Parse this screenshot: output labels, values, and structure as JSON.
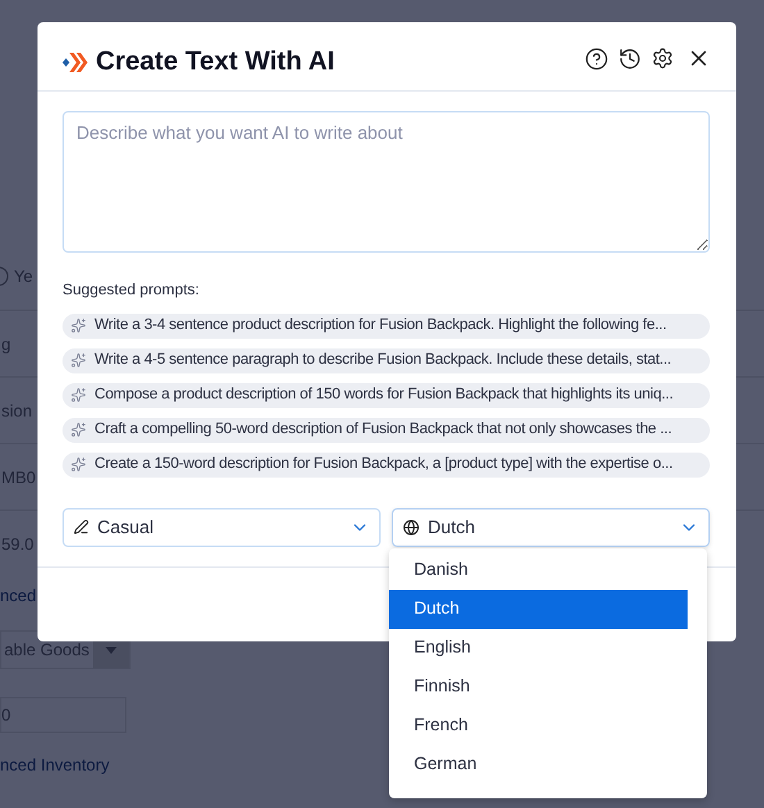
{
  "background": {
    "rows": [
      {
        "kind": "radio",
        "text": "Ye",
        "checked": false
      },
      {
        "kind": "text",
        "text": "g"
      },
      {
        "kind": "text",
        "text": "sion"
      },
      {
        "kind": "text",
        "text": "MB0"
      },
      {
        "kind": "text",
        "text": "59.0"
      },
      {
        "kind": "link",
        "text": "nced"
      },
      {
        "kind": "select",
        "text": "able Goods"
      },
      {
        "kind": "field",
        "text": "0"
      },
      {
        "kind": "link",
        "text": "nced Inventory"
      }
    ]
  },
  "dialog": {
    "title": "Create Text With AI",
    "placeholder": "Describe what you want AI to write about",
    "suggested_label": "Suggested prompts:",
    "prompts": [
      "Write a 3-4 sentence product description for Fusion Backpack. Highlight the following fe...",
      "Write a 4-5 sentence paragraph to describe Fusion Backpack. Include these details, stat...",
      "Compose a product description of 150 words for Fusion Backpack that highlights its uniq...",
      "Craft a compelling 50-word description of Fusion Backpack that not only showcases the ...",
      "Create a 150-word description for Fusion Backpack, a [product type] with the expertise o..."
    ],
    "tone": {
      "value": "Casual"
    },
    "language": {
      "value": "Dutch",
      "expanded": true,
      "options": [
        {
          "label": "Danish",
          "selected": false
        },
        {
          "label": "Dutch",
          "selected": true
        },
        {
          "label": "English",
          "selected": false
        },
        {
          "label": "Finnish",
          "selected": false
        },
        {
          "label": "French",
          "selected": false
        },
        {
          "label": "German",
          "selected": false
        }
      ]
    }
  }
}
